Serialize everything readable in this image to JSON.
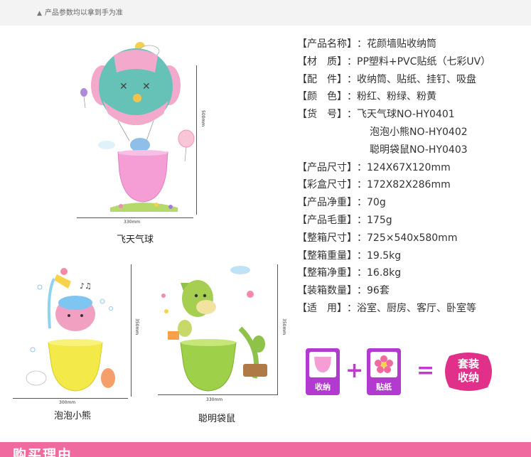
{
  "top_note": "产品参数均以拿到手为准",
  "specs": [
    {
      "label": "【产品名称】",
      "value": "：花颜墙贴收纳筒"
    },
    {
      "label": "【材　质】",
      "value": "：PP塑料+PVC贴纸（七彩UV）"
    },
    {
      "label": "【配　件】",
      "value": "：收纳筒、贴纸、挂钉、吸盘"
    },
    {
      "label": "【颜　色】",
      "value": "：粉红、粉绿、粉黄"
    },
    {
      "label": "【货　号】",
      "value": "：飞天气球NO-HY0401"
    },
    {
      "label": "",
      "value": "泡泡小熊NO-HY0402"
    },
    {
      "label": "",
      "value": "聪明袋鼠NO-HY0403"
    },
    {
      "label": "【产品尺寸】",
      "value": "：124X67X120mm"
    },
    {
      "label": "【彩盒尺寸】",
      "value": "：172X82X286mm"
    },
    {
      "label": "【产品净重】",
      "value": "：70g"
    },
    {
      "label": "【产品毛重】",
      "value": "：175g"
    },
    {
      "label": "【整箱尺寸】",
      "value": "：725×540x580mm"
    },
    {
      "label": "【整箱重量】",
      "value": "：19.5kg"
    },
    {
      "label": "【整箱净重】",
      "value": "：16.8kg"
    },
    {
      "label": "【装箱数量】",
      "value": "：96套"
    },
    {
      "label": "【适　用】",
      "value": "：浴室、厨房、客厅、卧室等"
    }
  ],
  "products": [
    {
      "caption": "飞天气球",
      "width_label": "330mm",
      "height_label": "500mm"
    },
    {
      "caption": "泡泡小熊",
      "width_label": "300mm",
      "height_label": "350mm"
    },
    {
      "caption": "聪明袋鼠",
      "width_label": "330mm",
      "height_label": "350mm"
    }
  ],
  "kit": {
    "item1": "收纳",
    "item2": "贴纸",
    "plus": "+",
    "equals": "=",
    "result_line1": "套装",
    "result_line2": "收纳"
  },
  "bottom_title": "购买理由",
  "colors": {
    "accent_pink": "#f06aa0",
    "purple": "#c03ad0",
    "magenta": "#e0308a"
  }
}
